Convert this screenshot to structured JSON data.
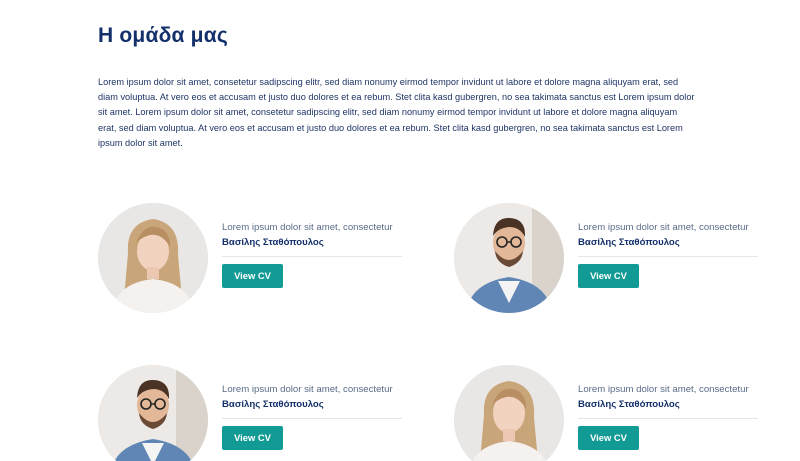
{
  "section": {
    "title": "Η ομάδα μας",
    "intro": "Lorem ipsum dolor sit amet, consetetur sadipscing elitr, sed diam nonumy eirmod tempor invidunt ut labore et dolore magna aliquyam erat, sed diam voluptua. At vero eos et accusam et justo duo dolores et ea rebum. Stet clita kasd gubergren, no sea takimata sanctus est Lorem ipsum dolor sit amet. Lorem ipsum dolor sit amet, consetetur sadipscing elitr, sed diam nonumy eirmod tempor invidunt ut labore et dolore magna aliquyam erat, sed diam voluptua. At vero eos et accusam et justo duo dolores et ea rebum. Stet clita kasd gubergren, no sea takimata sanctus est Lorem ipsum dolor sit amet."
  },
  "members": [
    {
      "role": "Lorem ipsum dolor sit amet, consectetur",
      "name": "Βασίλης Σταθόπουλος",
      "button": "View CV",
      "photo": "woman-portrait"
    },
    {
      "role": "Lorem ipsum dolor sit amet, consectetur",
      "name": "Βασίλης Σταθόπουλος",
      "button": "View CV",
      "photo": "man-portrait"
    },
    {
      "role": "Lorem ipsum dolor sit amet, consectetur",
      "name": "Βασίλης Σταθόπουλος",
      "button": "View CV",
      "photo": "man-portrait"
    },
    {
      "role": "Lorem ipsum dolor sit amet, consectetur",
      "name": "Βασίλης Σταθόπουλος",
      "button": "View CV",
      "photo": "woman-portrait"
    }
  ],
  "colors": {
    "title": "#14306b",
    "button": "#129a94",
    "divider": "#e3e6ea"
  }
}
